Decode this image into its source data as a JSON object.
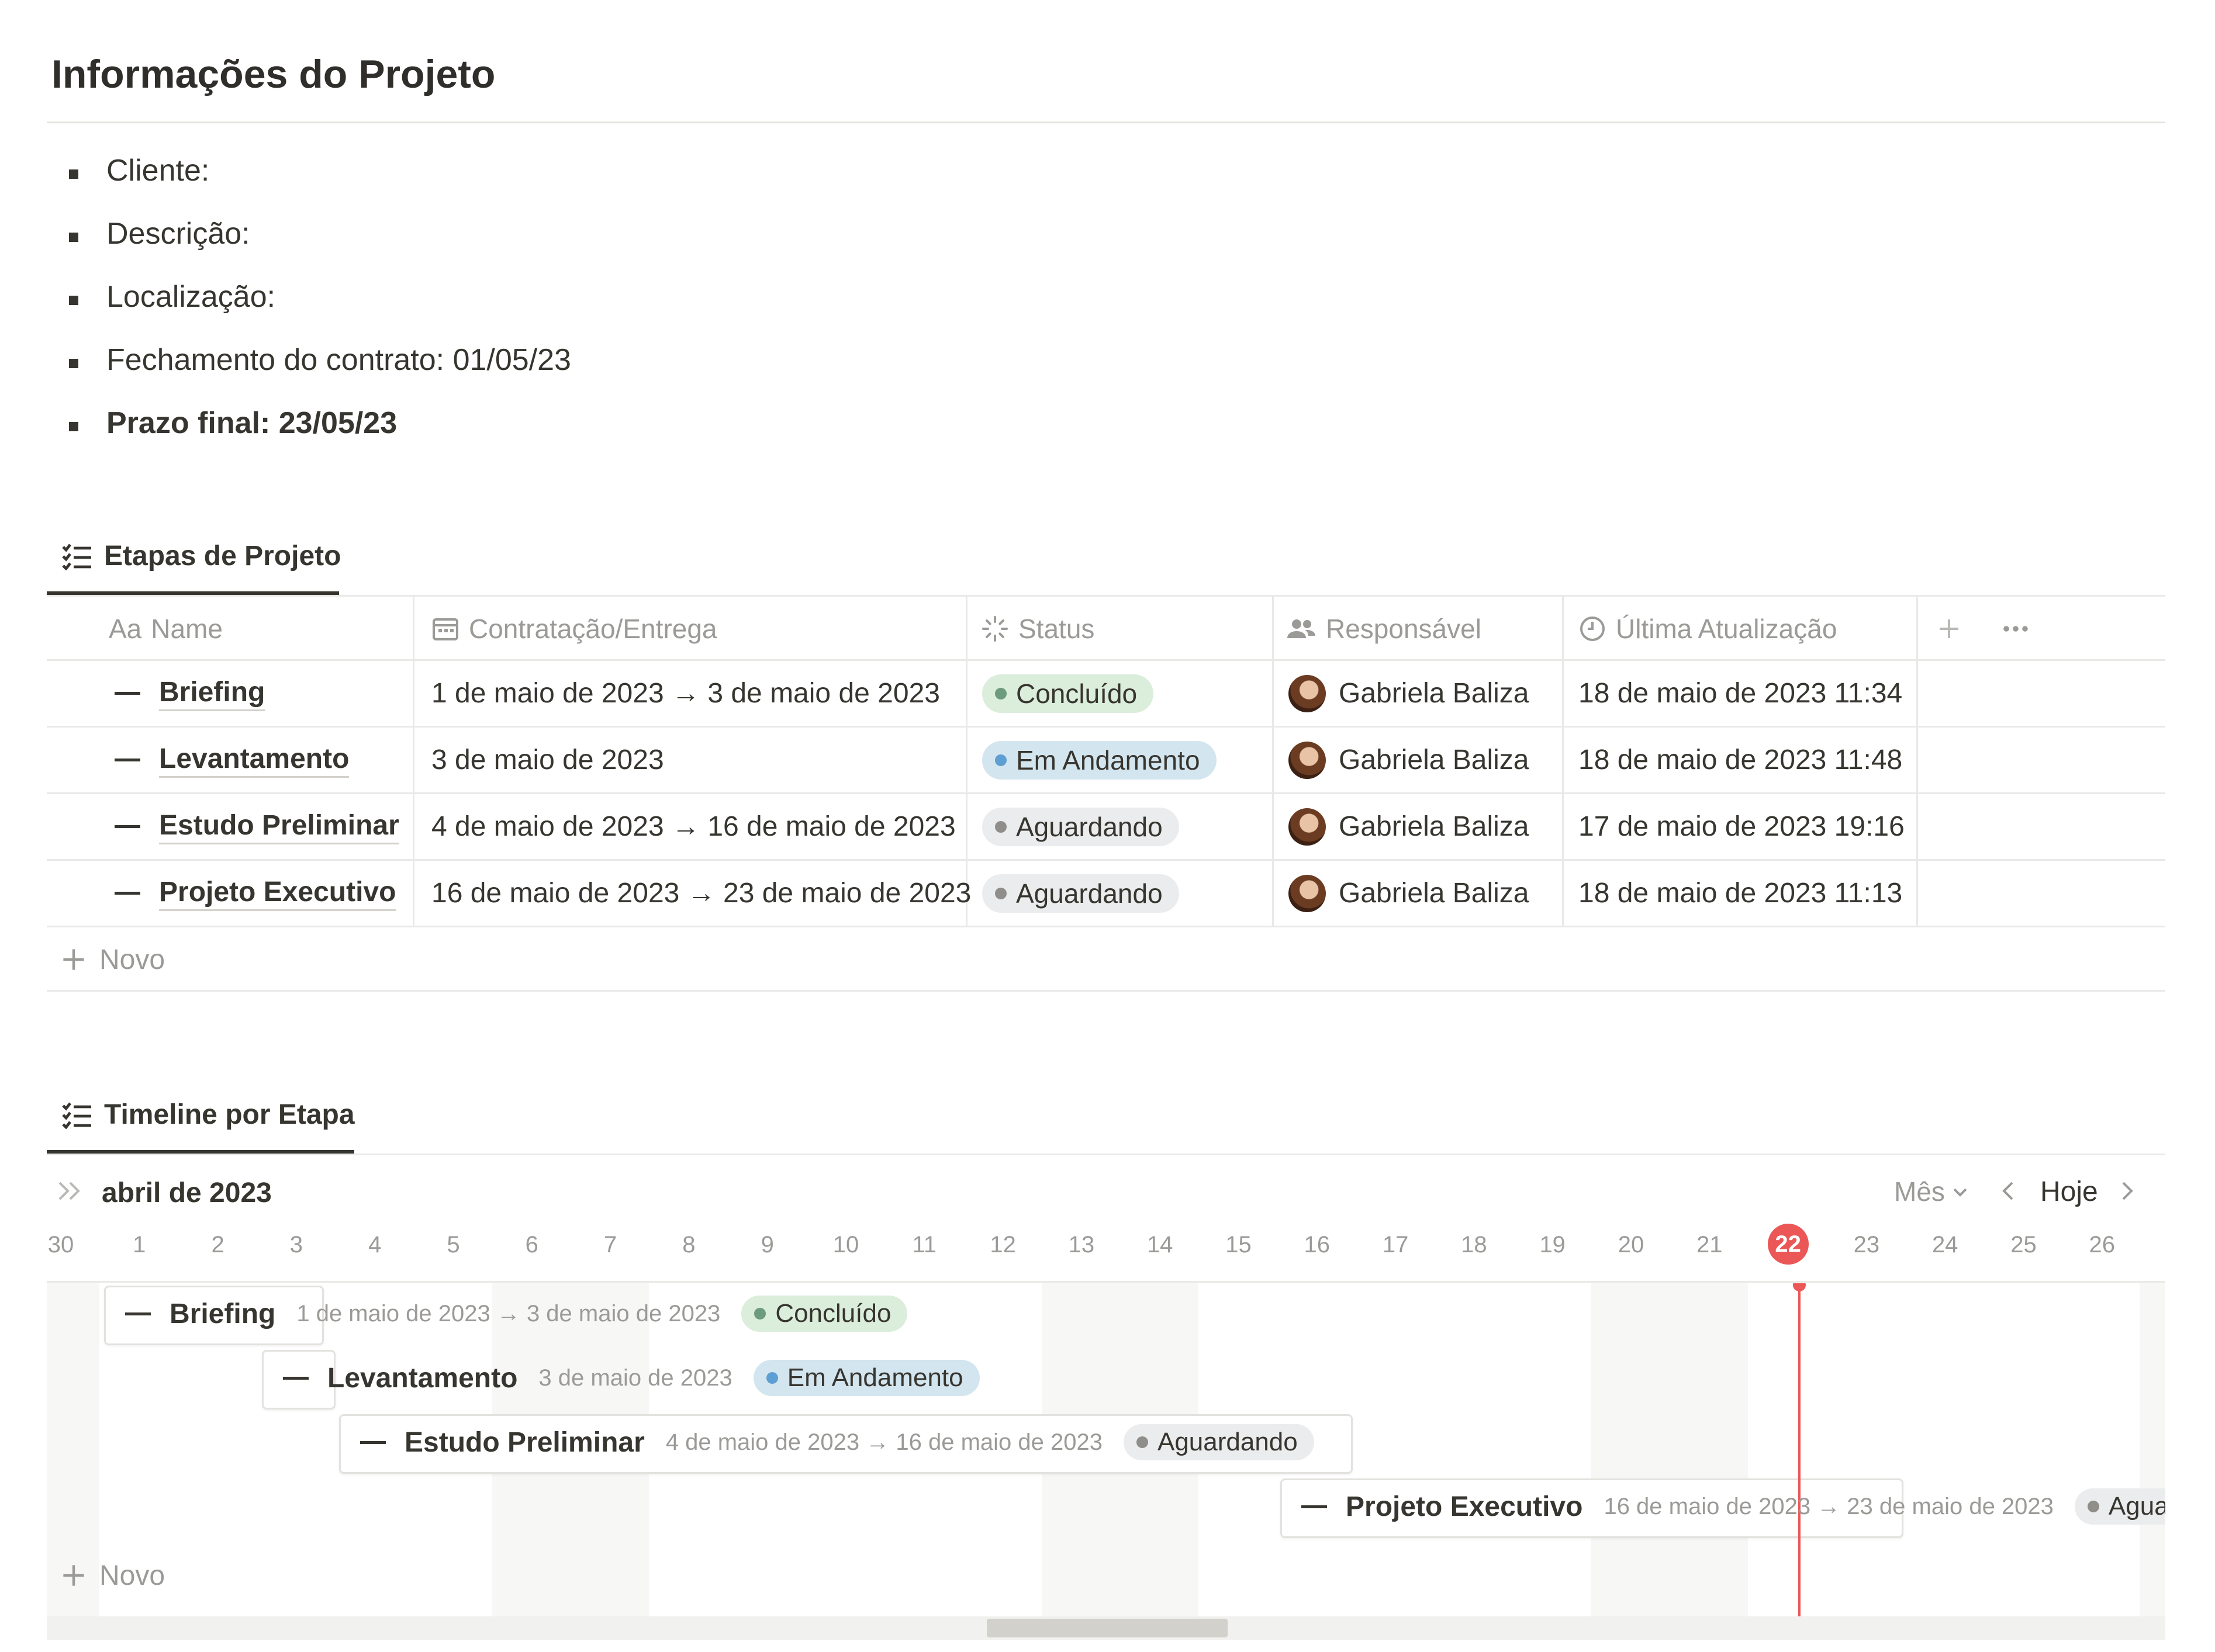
{
  "page": {
    "title": "Informações do Projeto",
    "info": [
      {
        "label": "Cliente:",
        "bold": false
      },
      {
        "label": "Descrição:",
        "bold": false
      },
      {
        "label": "Localização:",
        "bold": false
      },
      {
        "label": "Fechamento do contrato: 01/05/23",
        "bold": false
      },
      {
        "label": "Prazo final: 23/05/23",
        "bold": true
      }
    ]
  },
  "table_view": {
    "tab_label": "Etapas de Projeto",
    "columns": {
      "name": "Name",
      "name_prefix": "Aa",
      "dates": "Contratação/Entrega",
      "status": "Status",
      "owner": "Responsável",
      "updated": "Última Atualização"
    },
    "rows": [
      {
        "name": "Briefing",
        "dates": "1 de maio de 2023 → 3 de maio de 2023",
        "status": "Concluído",
        "owner": "Gabriela Baliza",
        "updated": "18 de maio de 2023 11:34"
      },
      {
        "name": "Levantamento",
        "dates": "3 de maio de 2023",
        "status": "Em Andamento",
        "owner": "Gabriela Baliza",
        "updated": "18 de maio de 2023 11:48"
      },
      {
        "name": "Estudo Preliminar",
        "dates": "4 de maio de 2023 → 16 de maio de 2023",
        "status": "Aguardando",
        "owner": "Gabriela Baliza",
        "updated": "17 de maio de 2023 19:16"
      },
      {
        "name": "Projeto Executivo",
        "dates": "16 de maio de 2023 → 23 de maio de 2023",
        "status": "Aguardando",
        "owner": "Gabriela Baliza",
        "updated": "18 de maio de 2023 11:13"
      }
    ],
    "new_label": "Novo"
  },
  "status_colors": {
    "Concluído": {
      "bg": "#dbeddb",
      "dot": "#6c9b7d"
    },
    "Em Andamento": {
      "bg": "#d3e5ef",
      "dot": "#5e9fd3"
    },
    "Aguardando": {
      "bg": "#ebeced",
      "dot": "#8f8e8b"
    }
  },
  "timeline_view": {
    "tab_label": "Timeline por Etapa",
    "month_label": "abril de 2023",
    "scale_label": "Mês",
    "today_button": "Hoje",
    "days": [
      "30",
      "1",
      "2",
      "3",
      "4",
      "5",
      "6",
      "7",
      "8",
      "9",
      "10",
      "11",
      "12",
      "13",
      "14",
      "15",
      "16",
      "17",
      "18",
      "19",
      "20",
      "21",
      "22",
      "23",
      "24",
      "25",
      "26"
    ],
    "today": "22",
    "items": [
      {
        "name": "Briefing",
        "dates": "1 de maio de 2023 → 3 de maio de 2023",
        "status": "Concluído"
      },
      {
        "name": "Levantamento",
        "dates": "3 de maio de 2023",
        "status": "Em Andamento"
      },
      {
        "name": "Estudo Preliminar",
        "dates": "4 de maio de 2023 → 16 de maio de 2023",
        "status": "Aguardando"
      },
      {
        "name": "Projeto Executivo",
        "dates": "16 de maio de 2023 → 23 de maio de 2023",
        "status": "Aguardando"
      }
    ],
    "new_label": "Novo"
  }
}
